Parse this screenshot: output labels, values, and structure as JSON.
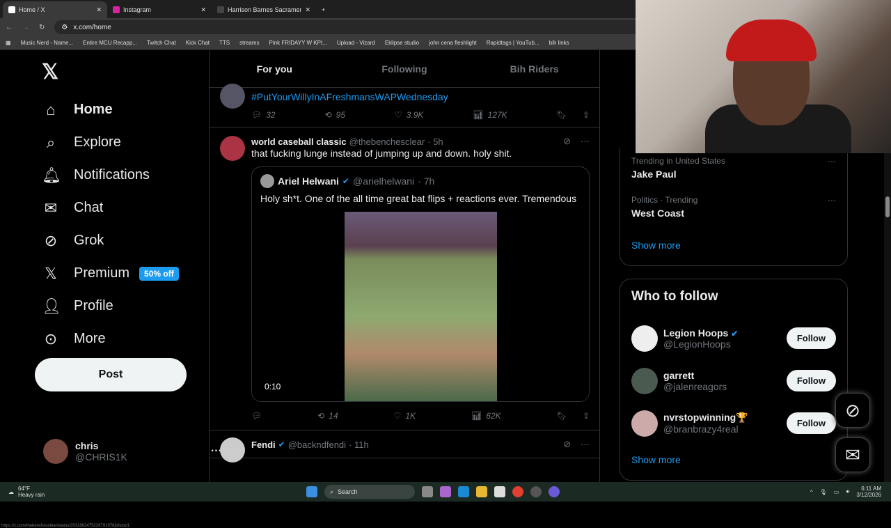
{
  "browser": {
    "tabs": [
      {
        "title": "Home / X",
        "active": true
      },
      {
        "title": "Instagram"
      },
      {
        "title": "Harrison Barnes Sacramento Ki"
      }
    ],
    "url": "x.com/home",
    "bookmarks": [
      "Music Nerd - Name...",
      "Entire MCU Recapp...",
      "Twitch Chat",
      "Kick Chat",
      "TTS",
      "streams",
      "Pink FRIDAYY W KPI...",
      "Upload - Vizard",
      "Eklipse studio",
      "john cena fleshlight",
      "Rapidtags | YouTub...",
      "bih links"
    ],
    "status_url": "https://x.com/thebenchesclear/status/2031862475226791976/photo/1"
  },
  "sidebar": {
    "items": [
      {
        "label": "Home",
        "icon": "home-icon"
      },
      {
        "label": "Explore",
        "icon": "search-icon"
      },
      {
        "label": "Notifications",
        "icon": "bell-icon"
      },
      {
        "label": "Chat",
        "icon": "mail-icon"
      },
      {
        "label": "Grok",
        "icon": "grok-icon"
      },
      {
        "label": "Premium",
        "icon": "x-icon",
        "badge": "50% off"
      },
      {
        "label": "Profile",
        "icon": "person-icon"
      },
      {
        "label": "More",
        "icon": "more-circle-icon"
      }
    ],
    "post_label": "Post",
    "user": {
      "name": "chris",
      "handle": "@CHRIS1K"
    }
  },
  "feed": {
    "tabs": [
      "For you",
      "Following",
      "Bih Riders"
    ],
    "tweets": [
      {
        "body": "#PutYourWillyInAFreshmansWAPWednesday",
        "replies": "32",
        "reposts": "95",
        "likes": "3.9K",
        "views": "127K"
      },
      {
        "name": "world caseball classic",
        "handle": "@thebenchesclear",
        "time": "· 5h",
        "body": "that fucking lunge instead of jumping up and down. holy shit.",
        "quote": {
          "name": "Ariel Helwani",
          "handle": "@arielhelwani",
          "time": "· 7h",
          "body": "Holy sh*t. One of the all time great bat flips + reactions ever. Tremendous",
          "duration": "0:10"
        },
        "replies": "",
        "reposts": "14",
        "likes": "1K",
        "views": "62K"
      },
      {
        "name": "Fendi",
        "handle": "@backndfendi",
        "time": "· 11h"
      }
    ]
  },
  "trends": [
    {
      "context": "Trending in United States",
      "title": "Jake Paul"
    },
    {
      "context": "Politics · Trending",
      "title": "West Coast"
    }
  ],
  "show_more": "Show more",
  "who_to_follow": {
    "title": "Who to follow",
    "follow_label": "Follow",
    "users": [
      {
        "name": "Legion Hoops",
        "handle": "@LegionHoops",
        "verified": true
      },
      {
        "name": "garrett",
        "handle": "@jalenreagors"
      },
      {
        "name": "nvrstopwinning🏆",
        "handle": "@branbrazy4real"
      }
    ]
  },
  "taskbar": {
    "temp": "64°F",
    "weather": "Heavy rain",
    "search": "Search",
    "time": "6:11 AM",
    "date": "3/12/2026"
  },
  "colors": {
    "accent": "#1d9bf0",
    "bg": "#000000"
  }
}
